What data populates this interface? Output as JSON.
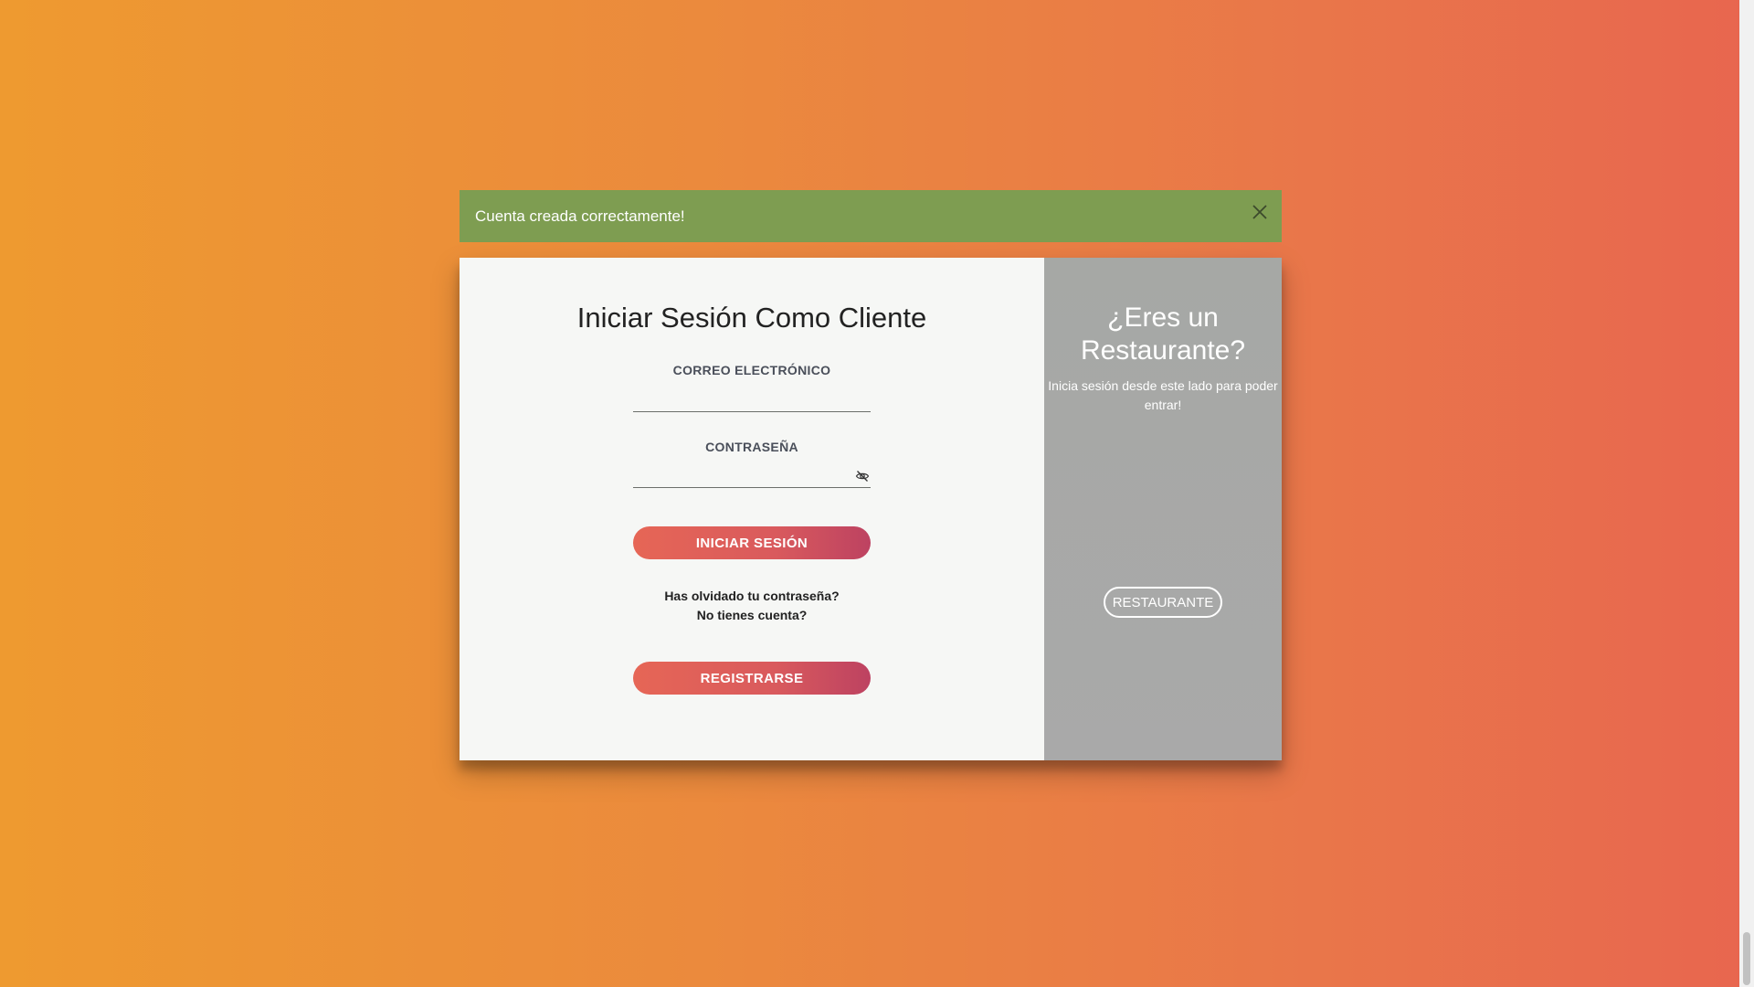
{
  "alert": {
    "message": "Cuenta creada correctamente!",
    "close_icon": "close-icon"
  },
  "login": {
    "title": "Iniciar Sesión Como Cliente",
    "email_label": "CORREO ELECTRÓNICO",
    "email_value": "",
    "password_label": "CONTRASEÑA",
    "password_value": "",
    "toggle_icon": "eye-slash-icon",
    "submit_label": "INICIAR SESIÓN",
    "forgot_link": "Has olvidado tu contraseña?",
    "no_account_text": "No tienes cuenta?",
    "register_label": "REGISTRARSE"
  },
  "restaurant": {
    "title": "¿Eres un Restaurante?",
    "subtitle": "Inicia sesión desde este lado para poder entrar!",
    "button_label": "RESTAURANTE"
  },
  "colors": {
    "background_start": "#ee9a30",
    "background_end": "#e8664f",
    "alert_bg": "#7e9d51",
    "button_start": "#e66656",
    "button_end": "#bd4261",
    "side_panel": "#a8a9a7"
  }
}
